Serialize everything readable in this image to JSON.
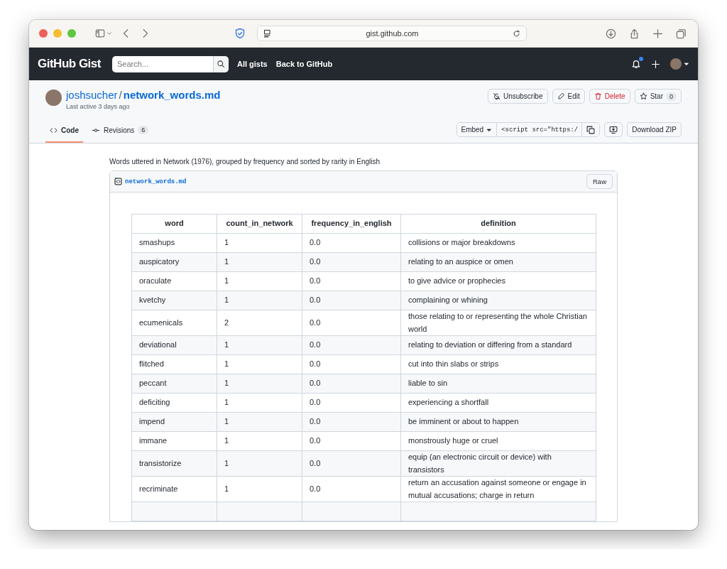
{
  "browser": {
    "address": "gist.github.com"
  },
  "header": {
    "logo": "GitHub Gist",
    "search": {
      "placeholder": "Search..."
    },
    "links": [
      "All gists",
      "Back to GitHub"
    ],
    "notification_unread": true
  },
  "gist": {
    "owner": "joshsucher",
    "separator": "/",
    "name": "network_words.md",
    "last_active": "Last active 3 days ago",
    "actions": [
      {
        "kind": "unsubscribe",
        "label": "Unsubscribe"
      },
      {
        "kind": "edit",
        "label": "Edit"
      },
      {
        "kind": "delete",
        "label": "Delete"
      },
      {
        "kind": "star",
        "label": "Star",
        "count": "0"
      }
    ],
    "tabs": [
      {
        "kind": "code",
        "label": "Code",
        "selected": true
      },
      {
        "kind": "revisions",
        "label": "Revisions",
        "count": "6",
        "selected": false
      }
    ],
    "embed": {
      "label": "Embed",
      "value": "<script src=\"https:/"
    },
    "download": "Download ZIP"
  },
  "description": "Words uttered in Network (1976), grouped by frequency and sorted by rarity in English",
  "file": {
    "name": "network_words.md",
    "raw": "Raw",
    "table": {
      "columns": [
        "word",
        "count_in_network",
        "frequency_in_english",
        "definition"
      ],
      "rows": [
        [
          "smashups",
          "1",
          "0.0",
          "collisions or major breakdowns"
        ],
        [
          "auspicatory",
          "1",
          "0.0",
          "relating to an auspice or omen"
        ],
        [
          "oraculate",
          "1",
          "0.0",
          "to give advice or prophecies"
        ],
        [
          "kvetchy",
          "1",
          "0.0",
          "complaining or whining"
        ],
        [
          "ecumenicals",
          "2",
          "0.0",
          "those relating to or representing the whole Christian world"
        ],
        [
          "deviational",
          "1",
          "0.0",
          "relating to deviation or differing from a standard"
        ],
        [
          "flitched",
          "1",
          "0.0",
          "cut into thin slabs or strips"
        ],
        [
          "peccant",
          "1",
          "0.0",
          "liable to sin"
        ],
        [
          "deficiting",
          "1",
          "0.0",
          "experiencing a shortfall"
        ],
        [
          "impend",
          "1",
          "0.0",
          "be imminent or about to happen"
        ],
        [
          "immane",
          "1",
          "0.0",
          "monstrously huge or cruel"
        ],
        [
          "transistorize",
          "1",
          "0.0",
          "equip (an electronic circuit or device) with transistors"
        ],
        [
          "recriminate",
          "1",
          "0.0",
          "return an accusation against someone or engage in mutual accusations; charge in return"
        ]
      ]
    }
  }
}
